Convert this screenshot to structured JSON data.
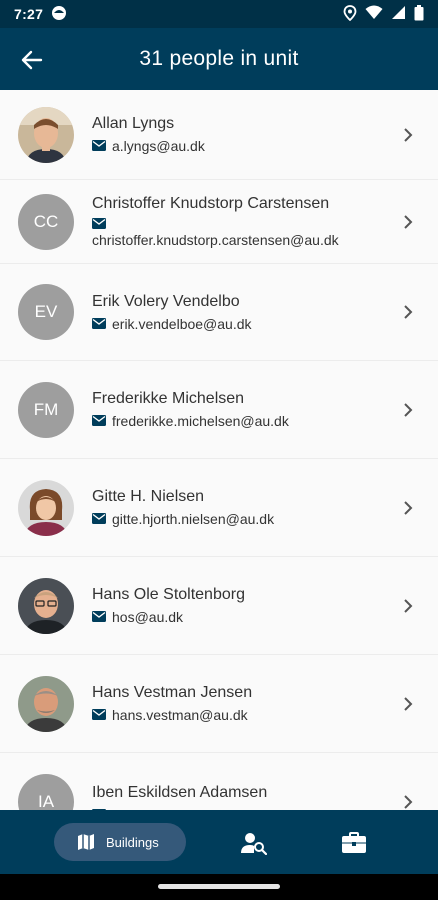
{
  "status_bar": {
    "time": "7:27"
  },
  "header": {
    "title": "31 people in unit"
  },
  "people": [
    {
      "name": "Allan Lyngs",
      "email": "a.lyngs@au.dk",
      "initials": "",
      "photo": "photo-allan"
    },
    {
      "name": "Christoffer Knudstorp Carstensen",
      "email": "christoffer.knudstorp.carstensen@au.dk",
      "initials": "CC",
      "photo": ""
    },
    {
      "name": "Erik Volery Vendelbo",
      "email": "erik.vendelboe@au.dk",
      "initials": "EV",
      "photo": ""
    },
    {
      "name": "Frederikke Michelsen",
      "email": "frederikke.michelsen@au.dk",
      "initials": "FM",
      "photo": ""
    },
    {
      "name": "Gitte H. Nielsen",
      "email": "gitte.hjorth.nielsen@au.dk",
      "initials": "",
      "photo": "photo-gitte"
    },
    {
      "name": "Hans Ole Stoltenborg",
      "email": "hos@au.dk",
      "initials": "",
      "photo": "photo-hans-ole"
    },
    {
      "name": "Hans Vestman Jensen",
      "email": "hans.vestman@au.dk",
      "initials": "",
      "photo": "photo-hans-vestman"
    },
    {
      "name": "Iben Eskildsen Adamsen",
      "email": "",
      "initials": "IA",
      "photo": ""
    }
  ],
  "bottom_nav": {
    "buildings_label": "Buildings"
  },
  "colors": {
    "primary": "#003d5b",
    "status_bar": "#003047",
    "pill": "#35597a",
    "avatar_grey": "#9e9e9e"
  }
}
